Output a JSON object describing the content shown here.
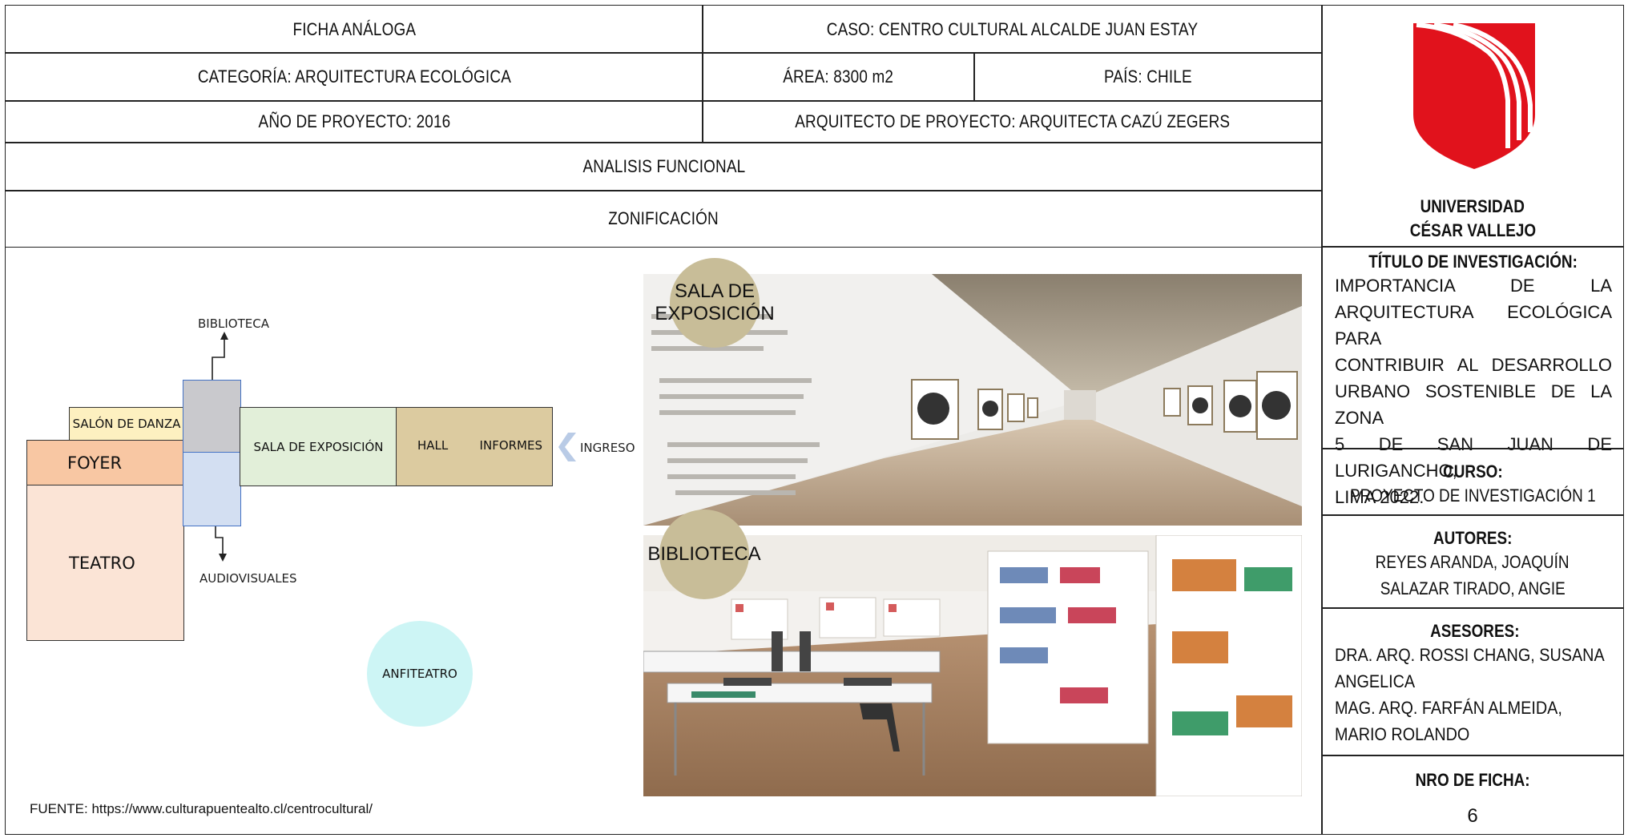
{
  "header": {
    "ficha": "FICHA ANÁLOGA",
    "caso": "CASO: CENTRO CULTURAL ALCALDE JUAN ESTAY",
    "categoria": "CATEGORÍA:  ARQUITECTURA ECOLÓGICA",
    "area": "ÁREA:  8300 m2",
    "pais": "PAÍS:  CHILE",
    "anio": "AÑO DE PROYECTO: 2016",
    "arquitecto": "ARQUITECTO DE PROYECTO: ARQUITECTA CAZÚ ZEGERS",
    "analisis": "ANALISIS FUNCIONAL",
    "zonificacion": "ZONIFICACIÓN"
  },
  "sidebar": {
    "university_line1": "UNIVERSIDAD",
    "university_line2": "CÉSAR VALLEJO",
    "titulo_label": "TÍTULO DE INVESTIGACIÓN:",
    "titulo_lines": [
      "IMPORTANCIA DE LA",
      "ARQUITECTURA ECOLÓGICA PARA",
      "CONTRIBUIR AL DESARROLLO",
      "URBANO SOSTENIBLE DE LA ZONA",
      "5 DE SAN JUAN DE LURIGANCHO,",
      "LIMA 2022."
    ],
    "curso_label": "CURSO:",
    "curso": "PROYECTO DE INVESTIGACIÓN 1",
    "autores_label": "AUTORES:",
    "autor1": "REYES ARANDA, JOAQUÍN",
    "autor2": "SALAZAR TIRADO, ANGIE",
    "asesores_label": "ASESORES:",
    "asesor1a": "DRA. ARQ. ROSSI CHANG, SUSANA",
    "asesor1b": "ANGELICA",
    "asesor2a": "MAG. ARQ. FARFÁN ALMEIDA,",
    "asesor2b": "MARIO ROLANDO",
    "ficha_label": "NRO DE FICHA:",
    "ficha_num": "6"
  },
  "diagram": {
    "biblioteca": "BIBLIOTECA",
    "salon_danza": "SALÓN DE DANZA",
    "foyer": "FOYER",
    "sala_exposicion": "SALA DE EXPOSICIÓN",
    "hall": "HALL",
    "informes": "INFORMES",
    "ingreso": "INGRESO",
    "teatro": "TEATRO",
    "audiovisuales": "AUDIOVISUALES",
    "anfiteatro": "ANFITEATRO",
    "colors": {
      "salon": "#fdf0c0",
      "foyer": "#f8c7a3",
      "teatro": "#fbe4d6",
      "vertical_top": "#c9c9cd",
      "vertical_bottom": "#d3dff2",
      "sala": "#e2efd9",
      "hall": "#dccba0",
      "anfiteatro": "#cdf5f5",
      "arrow": "#b9cbe6"
    }
  },
  "photos": {
    "badge1_line1": "SALA DE",
    "badge1_line2": "EXPOSICIÓN",
    "badge2": "BIBLIOTECA"
  },
  "fuente": "FUENTE:  https://www.culturapuentealto.cl/centrocultural/"
}
